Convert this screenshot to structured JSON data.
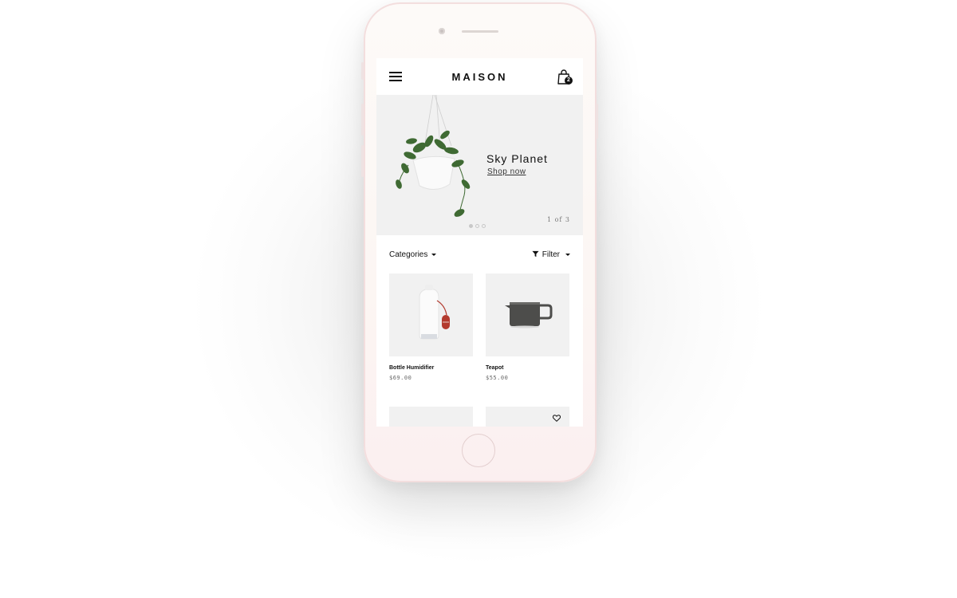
{
  "app": {
    "title": "MAISON",
    "cart_count": "2"
  },
  "hero": {
    "title": "Sky Planet",
    "link": "Shop now",
    "counter": "1 of 3",
    "slides_total": 3,
    "active_slide": 1
  },
  "toolbar": {
    "categories_label": "Categories",
    "filter_label": "Filter"
  },
  "products": [
    {
      "name": "Bottle Humidifier",
      "price": "$69.00",
      "icon": "bottle-humidifier-image"
    },
    {
      "name": "Teapot",
      "price": "$55.00",
      "icon": "teapot-image"
    },
    {
      "name": "",
      "price": "",
      "icon": "product-image-placeholder"
    },
    {
      "name": "",
      "price": "",
      "icon": "product-image-placeholder",
      "wishlist_icon": "heart-icon"
    }
  ],
  "colors": {
    "text": "#111111",
    "tile_bg": "#f1f1f1",
    "phone_frame": "#fcf6f3"
  }
}
